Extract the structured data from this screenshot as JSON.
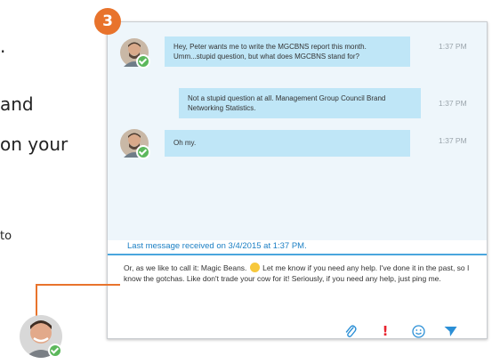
{
  "side": {
    "dot": ".",
    "and": "and",
    "on_your": "on your",
    "to": "to"
  },
  "step_badge": "3",
  "messages": [
    {
      "text": "Hey, Peter wants me to write the MGCBNS report this month. Umm...stupid question, but what does MGCBNS stand for?",
      "time": "1:37 PM",
      "has_avatar": true
    },
    {
      "text": "Not a stupid question at all. Management Group Council Brand Networking Statistics.",
      "time": "1:37 PM",
      "has_avatar": false
    },
    {
      "text": "Oh my.",
      "time": "1:37 PM",
      "has_avatar": true
    }
  ],
  "status": "Last message received on 3/4/2015 at 1:37 PM.",
  "compose": {
    "before_emoji": "Or, as we like to call it: Magic Beans.",
    "after_emoji": "Let me know if you need any help. I've done it in the past, so I know the gotchas. Like don't trade your cow for it! Seriously, if you need any help, just ping me."
  },
  "toolbar": {
    "attach_icon": "paperclip-icon",
    "importance": "!",
    "emoticon_icon": "smiley-icon",
    "send_icon": "send-icon"
  },
  "colors": {
    "accent": "#1b7fc4",
    "bubble": "#bfe6f7",
    "badge": "#e8732c",
    "importance": "#e8232e",
    "presence": "#5cb85c"
  }
}
